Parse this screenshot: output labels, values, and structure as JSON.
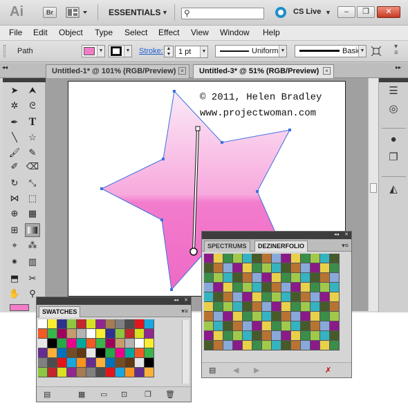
{
  "app": {
    "logo": "Ai",
    "bridge_label": "Br",
    "workspace": "ESSENTIALS",
    "search_placeholder": "",
    "cslive_label": "CS Live",
    "window_buttons": {
      "minimize": "–",
      "restore": "❐",
      "close": "✕"
    }
  },
  "menubar": {
    "items": [
      "File",
      "Edit",
      "Object",
      "Type",
      "Select",
      "Effect",
      "View",
      "Window",
      "Help"
    ]
  },
  "control": {
    "selection_label": "Path",
    "fill_color": "#f37cc8",
    "stroke_color": "#111111",
    "stroke_label": "Stroke:",
    "stroke_weight": "1 pt",
    "profile_label": "Uniform",
    "brush_label": "Basic"
  },
  "tabs": [
    {
      "label": "Untitled-1* @ 101% (RGB/Preview)",
      "close": "×",
      "active": false
    },
    {
      "label": "Untitled-3* @ 51% (RGB/Preview)",
      "close": "×",
      "active": true
    }
  ],
  "artwork": {
    "copyright_line1": "© 2011, Helen Bradley",
    "copyright_line2": "www.projectwoman.com",
    "star_gradient_top": "#fbeaf7",
    "star_gradient_bottom": "#f06fc9",
    "path_color": "#3c6fe0"
  },
  "tools": [
    "selection-tool",
    "direct-selection-tool",
    "magic-wand-tool",
    "lasso-tool",
    "pen-tool",
    "type-tool",
    "line-tool",
    "rectangle-tool",
    "paintbrush-tool",
    "pencil-tool",
    "blob-brush-tool",
    "eraser-tool",
    "rotate-tool",
    "scale-tool",
    "width-tool",
    "free-transform-tool",
    "shape-builder-tool",
    "perspective-grid-tool",
    "mesh-tool",
    "gradient-tool",
    "eyedropper-tool",
    "blend-tool",
    "symbol-sprayer-tool",
    "column-graph-tool",
    "artboard-tool",
    "slice-tool",
    "hand-tool",
    "zoom-tool"
  ],
  "swatches_panel": {
    "title": "SWATCHES",
    "collapse": "◂◂",
    "close": "✕",
    "footer": [
      "swatch-libraries-icon",
      "show-kinds-icon",
      "swatch-options-icon",
      "new-color-group-icon",
      "new-swatch-icon",
      "delete-swatch-icon"
    ]
  },
  "kuler_panel": {
    "tabs": [
      "SPECTRUMS",
      "DEZINERFOLIO"
    ],
    "collapse": "◂◂",
    "close": "✕",
    "footer": [
      "library-menu-icon",
      "previous-icon",
      "next-icon",
      "delete-icon"
    ]
  },
  "colors": {
    "dark_bar": "#3d3d3d",
    "panel_bg": "#d5d5d5"
  }
}
